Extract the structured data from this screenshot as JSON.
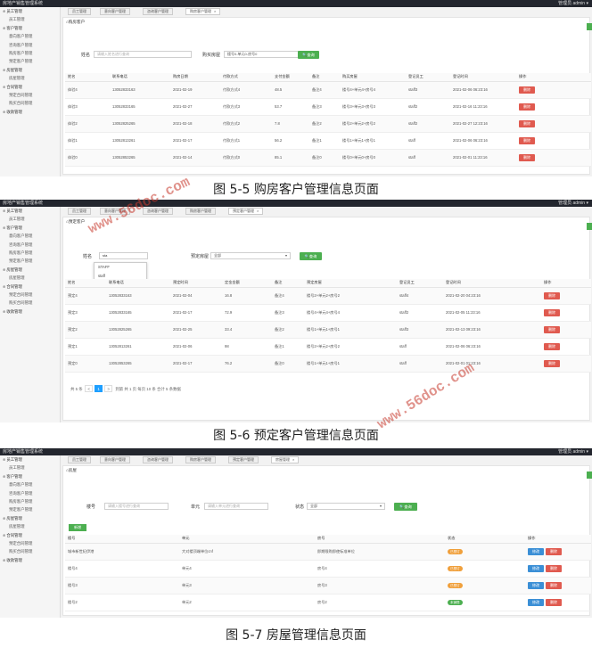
{
  "app_title": "房地产销售管理系统",
  "user": {
    "role": "管理员",
    "name": "admin",
    "arrow": "▾"
  },
  "sidebar": {
    "s1": [
      {
        "label": "员工管理",
        "type": "grp"
      },
      {
        "label": "员工管理",
        "type": "sub"
      },
      {
        "label": "客户管理",
        "type": "grp"
      },
      {
        "label": "意向客户管理",
        "type": "sub"
      },
      {
        "label": "咨询客户管理",
        "type": "sub"
      },
      {
        "label": "购房客户管理",
        "type": "sub"
      },
      {
        "label": "预定客户管理",
        "type": "sub"
      },
      {
        "label": "房屋管理",
        "type": "grp"
      },
      {
        "label": "房屋管理",
        "type": "sub"
      },
      {
        "label": "合同管理",
        "type": "grp"
      },
      {
        "label": "预定合同管理",
        "type": "sub"
      },
      {
        "label": "购买合同管理",
        "type": "sub"
      },
      {
        "label": "收款管理",
        "type": "grp"
      }
    ],
    "s3": [
      {
        "label": "员工管理",
        "type": "grp"
      },
      {
        "label": "员工管理",
        "type": "sub"
      },
      {
        "label": "客户管理",
        "type": "grp"
      },
      {
        "label": "意向客户管理",
        "type": "sub"
      },
      {
        "label": "咨询客户管理",
        "type": "sub"
      },
      {
        "label": "购房客户管理",
        "type": "sub"
      },
      {
        "label": "预定客户管理",
        "type": "sub"
      },
      {
        "label": "房屋管理",
        "type": "grp"
      },
      {
        "label": "房屋管理",
        "type": "sub"
      },
      {
        "label": "合同管理",
        "type": "grp"
      },
      {
        "label": "预定合同管理",
        "type": "sub"
      },
      {
        "label": "购买合同管理",
        "type": "sub"
      },
      {
        "label": "收款管理",
        "type": "grp"
      }
    ]
  },
  "tabs": {
    "s1": [
      "员工管理",
      "意向客户管理",
      "咨询客户管理",
      "购房客户管理"
    ],
    "s2": [
      "员工管理",
      "意向客户管理",
      "咨询客户管理",
      "购房客户管理",
      "预定客户管理"
    ],
    "s3": [
      "员工管理",
      "意向客户管理",
      "咨询客户管理",
      "购房客户管理",
      "预定客户管理",
      "房屋管理"
    ],
    "close": "×"
  },
  "s1": {
    "title": "购房客户",
    "name_label": "姓名",
    "name_placeholder": "请输入姓名进行查询",
    "house_label": "购买房屋",
    "house_value": "楼号0-单元0-房号0",
    "search_btn": "查询",
    "headers": [
      "姓名",
      "联系电话",
      "购房日期",
      "付款方式",
      "支付金额",
      "备注",
      "购买房屋",
      "登记员工",
      "登记时间",
      "操作"
    ],
    "rows": [
      [
        "体验4",
        "13052833163",
        "2021-02-19",
        "付款方式4",
        "48.5",
        "备注4",
        "楼号4+单元4+房号4",
        "staff3",
        "2021-02-06 06:23:16"
      ],
      [
        "体验3",
        "13052833165",
        "2021-02-27",
        "付款方式3",
        "53.7",
        "备注3",
        "楼号3+单元3+房号3",
        "staff2",
        "2021-02-16 11:23:16"
      ],
      [
        "体验2",
        "13052825265",
        "2021-02-18",
        "付款方式2",
        "7.8",
        "备注2",
        "楼号2+单元2+房号2",
        "staff2",
        "2021-02-27 12:23:16"
      ],
      [
        "体验1",
        "13052813261",
        "2021-02-17",
        "付款方式1",
        "56.2",
        "备注1",
        "楼号1+单元1+房号1",
        "staff",
        "2021-02-06 06:23:16"
      ],
      [
        "体验0",
        "13052853265",
        "2021-02-14",
        "付款方式0",
        "85.1",
        "备注0",
        "楼号0+单元0+房号0",
        "staff",
        "2021-02-01 11:23:16"
      ]
    ],
    "delete": "删除"
  },
  "caption1": "图 5-5 购房客户管理信息页面",
  "s2": {
    "title": "预定客户",
    "name_label": "姓名",
    "name_value": "sta",
    "dropdown": [
      "STAFF",
      "staff"
    ],
    "house_label": "预定房屋",
    "house_value": "全部",
    "search_btn": "查询",
    "headers": [
      "姓名",
      "联系电话",
      "预定时间",
      "定金金额",
      "备注",
      "预定房屋",
      "登记员工",
      "登记时间",
      "操作"
    ],
    "rows": [
      [
        "预定4",
        "13052833163",
        "2021-02-04",
        "16.8",
        "备注4",
        "楼号2+单元2+房号2",
        "staff4",
        "2021-02-20 04:23:16"
      ],
      [
        "预定3",
        "13052833165",
        "2021-02-17",
        "72.9",
        "备注3",
        "楼号4+单元4+房号4",
        "staff2",
        "2021-02-05 11:23:16"
      ],
      [
        "预定2",
        "13052825265",
        "2021-02-25",
        "33.4",
        "备注2",
        "楼号1+单元1+房号1",
        "staff3",
        "2021-02-13 09:23:16"
      ],
      [
        "预定1",
        "13052813261",
        "2021-02-06",
        "98",
        "备注1",
        "楼号2+单元2+房号2",
        "staff",
        "2021-02-06 06:23:16"
      ],
      [
        "预定0",
        "13052853265",
        "2021-02-17",
        "76.2",
        "备注0",
        "楼号1+单元1+房号1",
        "staff",
        "2021-02-01 01:23:16"
      ]
    ],
    "delete": "删除",
    "pager": {
      "total": "共 5 条",
      "prev": "<",
      "page": "1",
      "next": ">",
      "goto": "到第",
      "page_unit": "页",
      "confirm": "确定",
      "per": "共 1 页",
      "size": "每页 10 条",
      "count": "合计 5 条数据"
    }
  },
  "caption2": "图 5-6 预定客户管理信息页面",
  "s3": {
    "title": "房屋",
    "lou_label": "楼号",
    "lou_placeholder": "请输入楼号进行查询",
    "unit_label": "单元",
    "unit_placeholder": "请输入单元进行查询",
    "state_label": "状态",
    "state_value": "全部",
    "search_btn": "查询",
    "add_btn": "新增",
    "headers": [
      "楼号",
      "单元",
      "房号",
      "状态",
      "操作"
    ],
    "rows": [
      {
        "c": [
          "城市新世纪伊港",
          "大对楼顶端单位cnf",
          "即期限购即使标准单位"
        ],
        "state": "已预订",
        "color": "#f0a03c"
      },
      {
        "c": [
          "楼号4",
          "单元4",
          "房号4"
        ],
        "state": "已预订",
        "color": "#f0a03c"
      },
      {
        "c": [
          "楼号3",
          "单元3",
          "房号3"
        ],
        "state": "已预订",
        "color": "#f0a03c"
      },
      {
        "c": [
          "楼号2",
          "单元2",
          "房号2"
        ],
        "state": "未销售",
        "color": "#4caf50"
      }
    ],
    "modify": "修改",
    "delete": "删除"
  },
  "caption3": "图 5-7 房屋管理信息页面",
  "watermark": "www.56doc.com"
}
